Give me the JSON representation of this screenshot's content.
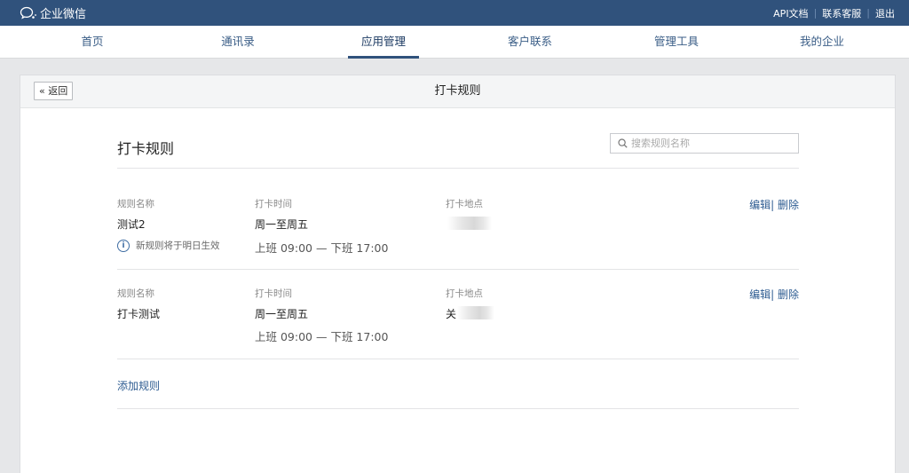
{
  "topbar": {
    "brand": "企业微信",
    "links": [
      "API文档",
      "联系客服",
      "退出"
    ]
  },
  "nav": {
    "items": [
      "首页",
      "通讯录",
      "应用管理",
      "客户联系",
      "管理工具",
      "我的企业"
    ],
    "active": "应用管理"
  },
  "panel": {
    "back_label": "« 返回",
    "title": "打卡规则"
  },
  "section": {
    "title": "打卡规则",
    "search_placeholder": "搜索规则名称"
  },
  "columns": {
    "name": "规则名称",
    "time": "打卡时间",
    "place": "打卡地点"
  },
  "rules": [
    {
      "name": "测试2",
      "days": "周一至周五",
      "hours": "上班 09:00 — 下班 17:00",
      "place_visible": "",
      "notice": "新规则将于明日生效",
      "edit": "编辑",
      "delete": "删除"
    },
    {
      "name": "打卡测试",
      "days": "周一至周五",
      "hours": "上班 09:00 — 下班 17:00",
      "place_visible": "关",
      "notice": "",
      "edit": "编辑",
      "delete": "删除"
    }
  ],
  "add_rule_label": "添加规则",
  "colors": {
    "topbar": "#30527c",
    "link": "#2f5d92",
    "background": "#e6e7e9"
  },
  "icons": {
    "brand": "wechat-work-logo-icon",
    "search": "search-icon",
    "notice": "info-icon"
  }
}
